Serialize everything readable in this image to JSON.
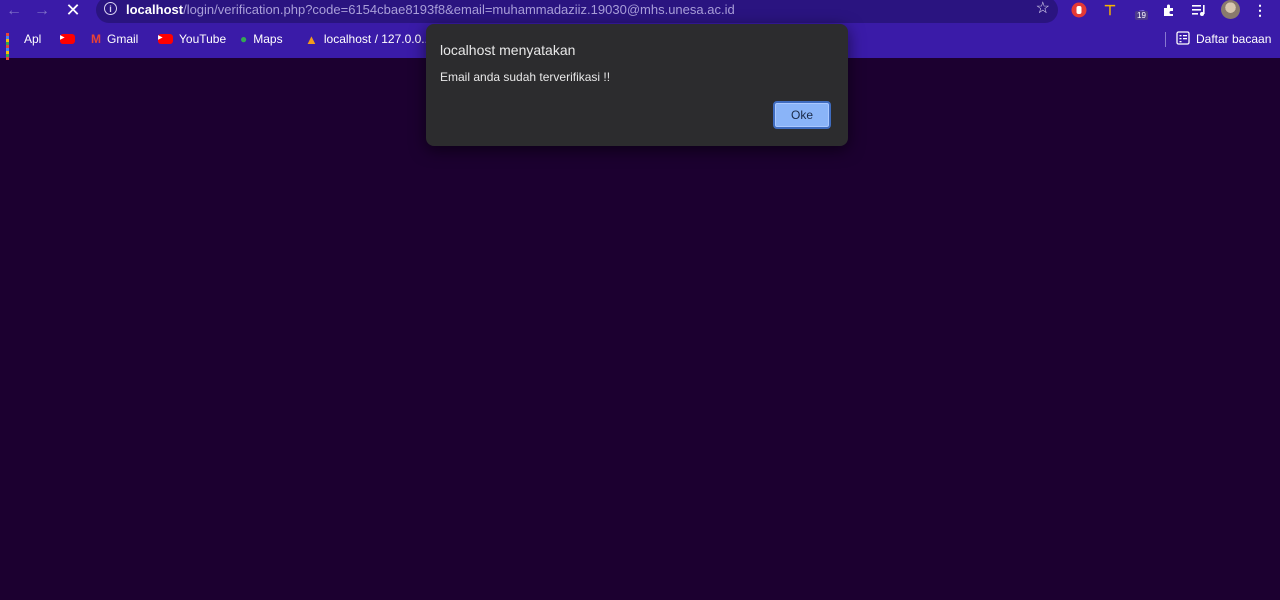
{
  "browser": {
    "url_host": "localhost",
    "url_path": "/login/verification.php?code=6154cbae8193f8&email=muhammadaziiz.19030@mhs.unesa.ac.id",
    "extension_badge": "19",
    "icons": {
      "back": "back-arrow-icon",
      "forward": "forward-arrow-icon",
      "stop": "stop-loading-icon",
      "info": "site-info-icon",
      "star": "bookmark-star-icon",
      "extensions": "puzzle-icon",
      "menu": "more-vert-icon"
    },
    "accent_color": "#3a1ba8"
  },
  "bookmarks": {
    "items": [
      {
        "label": "Apl",
        "icon": "apps-grid-icon"
      },
      {
        "label": "",
        "icon": "youtube-icon"
      },
      {
        "label": "Gmail",
        "icon": "gmail-icon"
      },
      {
        "label": "YouTube",
        "icon": "youtube-icon"
      },
      {
        "label": "Maps",
        "icon": "maps-icon"
      },
      {
        "label": "localhost / 127.0.0....",
        "icon": "phpmyadmin-icon"
      }
    ],
    "reading_list": "Daftar bacaan"
  },
  "dialog": {
    "title": "localhost menyatakan",
    "message": "Email anda sudah terverifikasi !!",
    "ok_label": "Oke"
  },
  "page": {
    "background": "#1c0030"
  }
}
